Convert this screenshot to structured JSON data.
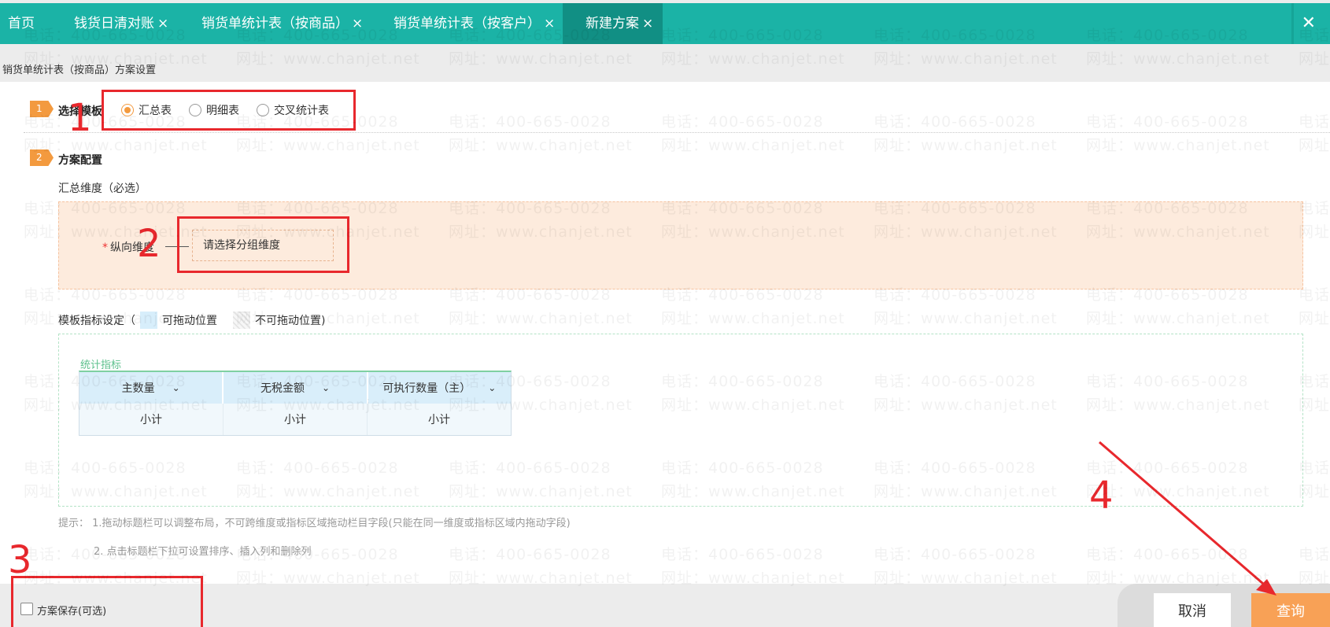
{
  "tabs": [
    {
      "label": "首页",
      "closable": false,
      "active": false
    },
    {
      "label": "钱货日清对账",
      "closable": true,
      "active": false
    },
    {
      "label": "销货单统计表（按商品）",
      "closable": true,
      "active": false
    },
    {
      "label": "销货单统计表（按客户）",
      "closable": true,
      "active": false
    },
    {
      "label": "新建方案",
      "closable": true,
      "active": true
    }
  ],
  "tab_close_glyph": "×",
  "window_close_glyph": "✕",
  "page_title": "销货单统计表（按商品）方案设置",
  "step1": {
    "number": "1",
    "label": "选择模板",
    "options": [
      "汇总表",
      "明细表",
      "交叉统计表"
    ],
    "selected": "汇总表"
  },
  "step2": {
    "number": "2",
    "label": "方案配置"
  },
  "summary_dimension": {
    "label": "汇总维度（必选）",
    "required_mark": "*",
    "vertical_label": "纵向维度",
    "placeholder": "请选择分组维度"
  },
  "template_metrics": {
    "label_prefix": "模板指标设定（",
    "draggable_label": "可拖动位置",
    "non_draggable_label": "不可拖动位置)",
    "section_title": "统计指标",
    "columns": [
      "主数量",
      "无税金额",
      "可执行数量（主）"
    ],
    "subtotals": [
      "小计",
      "小计",
      "小计"
    ]
  },
  "hints": {
    "line1": "提示： 1.拖动标题栏可以调整布局，不可跨维度或指标区域拖动栏目字段(只能在同一维度或指标区域内拖动字段)",
    "line2": "2. 点击标题栏下拉可设置排序、插入列和删除列"
  },
  "footer": {
    "save_label": "方案保存(可选)",
    "cancel_label": "取消",
    "query_label": "查询"
  },
  "annotations": [
    "1",
    "2",
    "3",
    "4"
  ],
  "watermark": {
    "phone": "电话：400-665-0028",
    "site": "网址：www.chanjet.net"
  },
  "colors": {
    "tab_bar": "#1bb3a6",
    "tab_active": "#118f84",
    "step_flag": "#f39a3f",
    "query_button": "#f8a156",
    "annotation_red": "#e8282d"
  }
}
